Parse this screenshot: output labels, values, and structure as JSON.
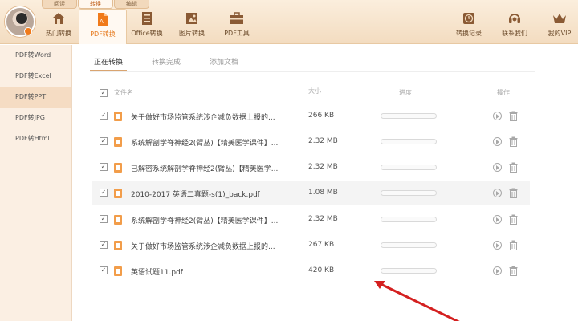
{
  "mode_tabs": [
    "阅读",
    "转换",
    "编辑"
  ],
  "nav_left": [
    {
      "label": "热门转换",
      "icon": "home-icon"
    },
    {
      "label": "PDF转换",
      "icon": "pdf-convert-icon"
    },
    {
      "label": "Office转换",
      "icon": "office-convert-icon"
    },
    {
      "label": "图片转换",
      "icon": "image-convert-icon"
    },
    {
      "label": "PDF工具",
      "icon": "toolbox-icon"
    }
  ],
  "nav_right": [
    {
      "label": "转换记录",
      "icon": "clock-icon"
    },
    {
      "label": "联系我们",
      "icon": "headset-icon"
    },
    {
      "label": "我的VIP",
      "icon": "crown-icon"
    }
  ],
  "sidebar": [
    {
      "label": "PDF转Word"
    },
    {
      "label": "PDF转Excel"
    },
    {
      "label": "PDF转PPT",
      "active": true
    },
    {
      "label": "PDF转JPG"
    },
    {
      "label": "PDF转Html"
    }
  ],
  "content_tabs": [
    "正在转换",
    "转换完成",
    "添加文档"
  ],
  "columns": {
    "name": "文件名",
    "size": "大小",
    "progress": "进度",
    "action": "操作"
  },
  "files": [
    {
      "name": "关于做好市场监管系统涉企减负数据上报的...",
      "size": "266 KB",
      "progress": 0
    },
    {
      "name": "系统解剖学脊神经2(臂丛)【精美医学课件】...",
      "size": "2.32 MB",
      "progress": 0
    },
    {
      "name": "已解密系统解剖学脊神经2(臂丛)【精美医学...",
      "size": "2.32 MB",
      "progress": 0
    },
    {
      "name": "2010-2017 英语二真题-s(1)_back.pdf",
      "size": "1.08 MB",
      "progress": 0
    },
    {
      "name": "系统解剖学脊神经2(臂丛)【精美医学课件】...",
      "size": "2.32 MB",
      "progress": 0
    },
    {
      "name": "关于做好市场监管系统涉企减负数据上报的...",
      "size": "267 KB",
      "progress": 0
    },
    {
      "name": "英语试题11.pdf",
      "size": "420 KB",
      "progress": 0
    }
  ],
  "colors": {
    "accent": "#e67a1e",
    "file_icon": "#f29d4a",
    "annotation_arrow": "#d42020"
  }
}
